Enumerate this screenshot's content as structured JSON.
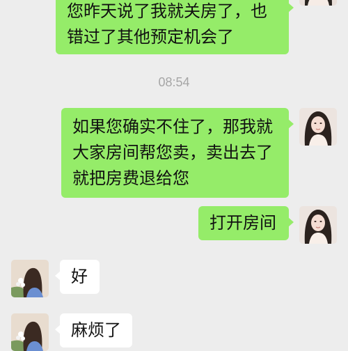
{
  "chat": {
    "messages": [
      {
        "lines": [
          "您昨天说了我就关房了，也",
          "错过了其他预定机会了"
        ]
      },
      {
        "lines": [
          "如果您确实不住了，那我就",
          "大家房间帮您卖，卖出去了",
          "就把房费退给您"
        ]
      },
      {
        "lines": [
          "打开房间"
        ]
      },
      {
        "lines": [
          "好"
        ]
      },
      {
        "lines": [
          "麻烦了"
        ]
      }
    ],
    "timestamp": "08:54"
  }
}
